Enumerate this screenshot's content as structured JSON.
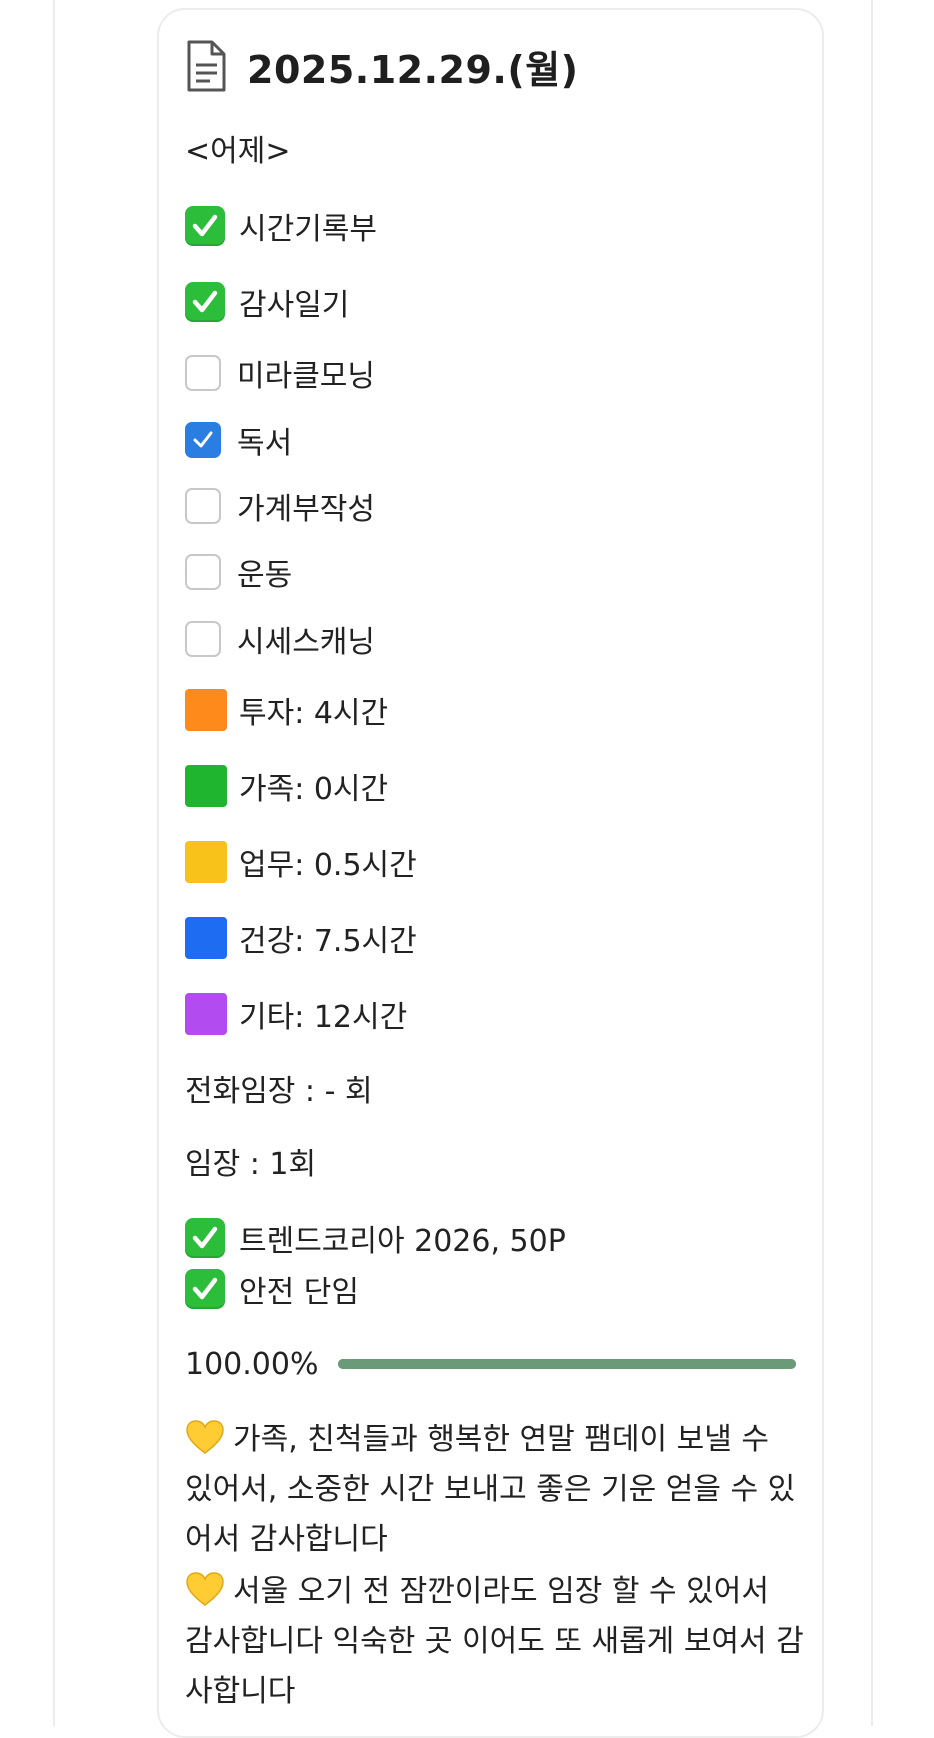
{
  "title": "2025.12.29.(월)",
  "section_label": "<어제>",
  "habits": [
    {
      "label": "시간기록부",
      "state": "done-emoji"
    },
    {
      "label": "감사일기",
      "state": "done-emoji"
    },
    {
      "label": "미라클모닝",
      "state": "unchecked"
    },
    {
      "label": "독서",
      "state": "checked"
    },
    {
      "label": "가계부작성",
      "state": "unchecked"
    },
    {
      "label": "운동",
      "state": "unchecked"
    },
    {
      "label": "시세스캐닝",
      "state": "unchecked"
    }
  ],
  "time_log": [
    {
      "label": "투자: 4시간",
      "color": "#ff8a1c"
    },
    {
      "label": "가족: 0시간",
      "color": "#1fb52e"
    },
    {
      "label": "업무: 0.5시간",
      "color": "#f8c21a"
    },
    {
      "label": "건강: 7.5시간",
      "color": "#1e6cf2"
    },
    {
      "label": "기타: 12시간",
      "color": "#b24cf0"
    }
  ],
  "phone_visit": "전화임장 : - 회",
  "site_visit": "임장 : 1회",
  "reading": [
    {
      "label": "트렌드코리아 2026, 50P"
    },
    {
      "label": "안전 단임"
    }
  ],
  "progress": {
    "label": "100.00%",
    "value": 1.0,
    "color": "#6b9a78"
  },
  "gratitude": [
    "가족, 친척들과 행복한 연말 팸데이 보낼 수 있어서, 소중한 시간 보내고 좋은 기운 얻을 수 있어서 감사합니다",
    "서울 오기 전 잠깐이라도 임장 할 수 있어서 감사합니다 익숙한 곳 이어도 또 새롭게 보여서 감사합니다"
  ],
  "icons": {
    "document": "document-icon",
    "check_emoji": "check-mark-button-icon",
    "heart": "yellow-heart-icon"
  }
}
